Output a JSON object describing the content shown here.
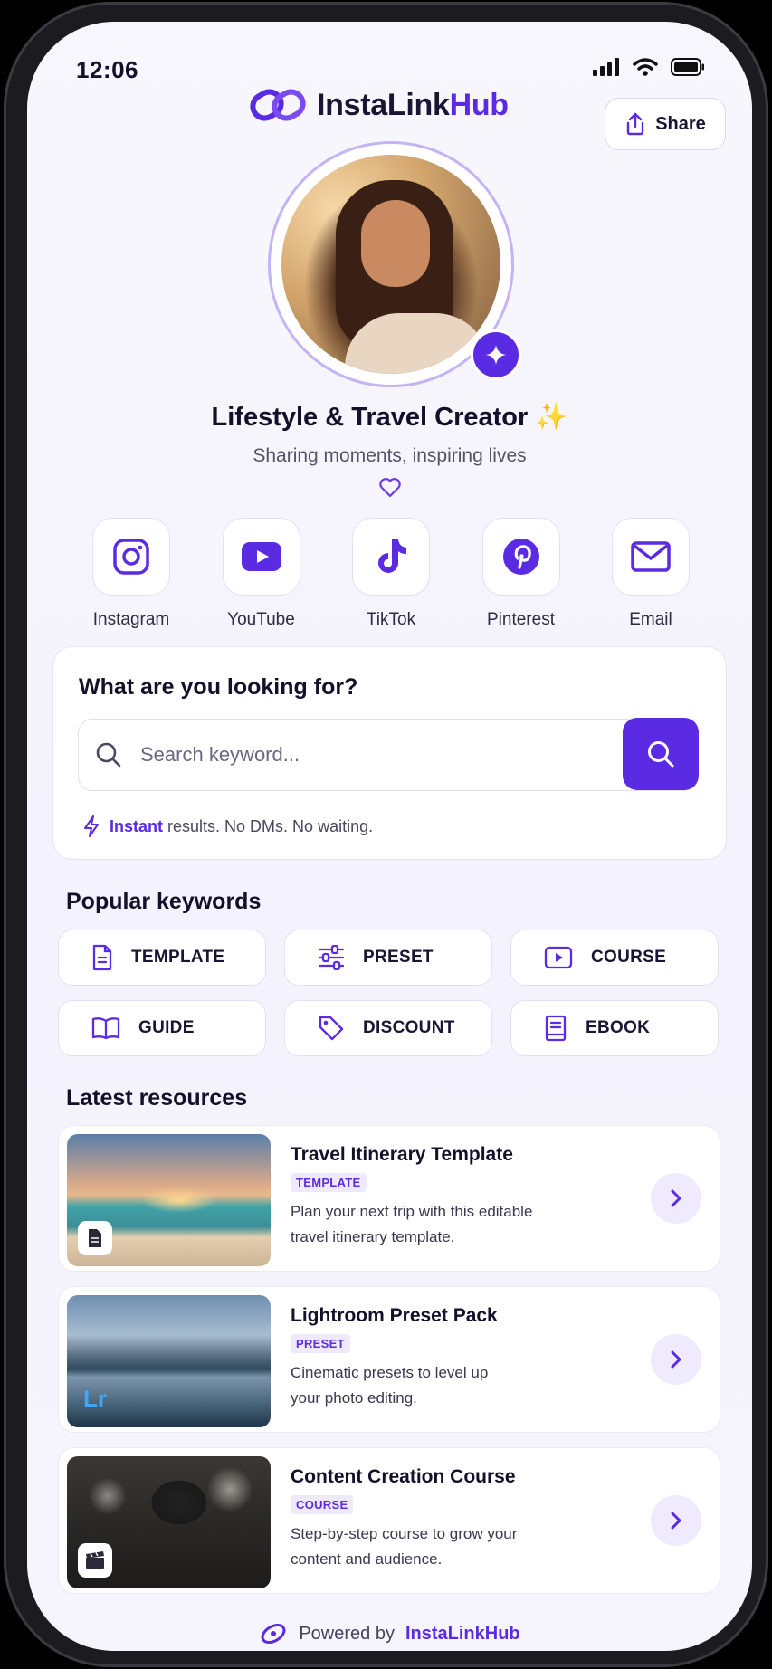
{
  "status_bar": {
    "time": "12:06",
    "icons": [
      "signal-icon",
      "wifi-icon",
      "battery-icon"
    ]
  },
  "header": {
    "brand_part1": "InstaLink",
    "brand_part2": "Hub",
    "share_label": "Share",
    "brand_color": "#5b2be3"
  },
  "profile": {
    "name": "Lifestyle & Travel Creator",
    "name_emoji": "✨",
    "bio": "Sharing moments, inspiring lives"
  },
  "socials": [
    {
      "label": "Instagram",
      "icon": "instagram-icon"
    },
    {
      "label": "YouTube",
      "icon": "youtube-icon"
    },
    {
      "label": "TikTok",
      "icon": "tiktok-icon"
    },
    {
      "label": "Pinterest",
      "icon": "pinterest-icon"
    },
    {
      "label": "Email",
      "icon": "mail-icon"
    }
  ],
  "search": {
    "title": "What are you looking for?",
    "placeholder": "Search keyword...",
    "value": "",
    "note_accent": "Instant",
    "note_rest": "results. No DMs. No waiting."
  },
  "keywords": {
    "title": "Popular keywords",
    "items": [
      {
        "label": "TEMPLATE",
        "icon": "document-icon"
      },
      {
        "label": "PRESET",
        "icon": "sliders-icon"
      },
      {
        "label": "COURSE",
        "icon": "play-icon"
      },
      {
        "label": "GUIDE",
        "icon": "book-icon"
      },
      {
        "label": "DISCOUNT",
        "icon": "tag-icon"
      },
      {
        "label": "EBOOK",
        "icon": "ebook-icon"
      }
    ]
  },
  "resources": {
    "title": "Latest resources",
    "items": [
      {
        "title": "Travel Itinerary Template",
        "tag": "TEMPLATE",
        "desc_line1": "Plan your next trip with this editable",
        "desc_line2": "travel itinerary template.",
        "thumb_badge": "document-icon"
      },
      {
        "title": "Lightroom Preset Pack",
        "tag": "PRESET",
        "desc_line1": "Cinematic presets to level up",
        "desc_line2": "your photo editing.",
        "thumb_badge": "Lr"
      },
      {
        "title": "Content Creation Course",
        "tag": "COURSE",
        "desc_line1": "Step-by-step course to grow your",
        "desc_line2": "content and audience.",
        "thumb_badge": "clapperboard-icon"
      }
    ]
  },
  "footer": {
    "prefix": "Powered by",
    "brand": "InstaLinkHub"
  }
}
